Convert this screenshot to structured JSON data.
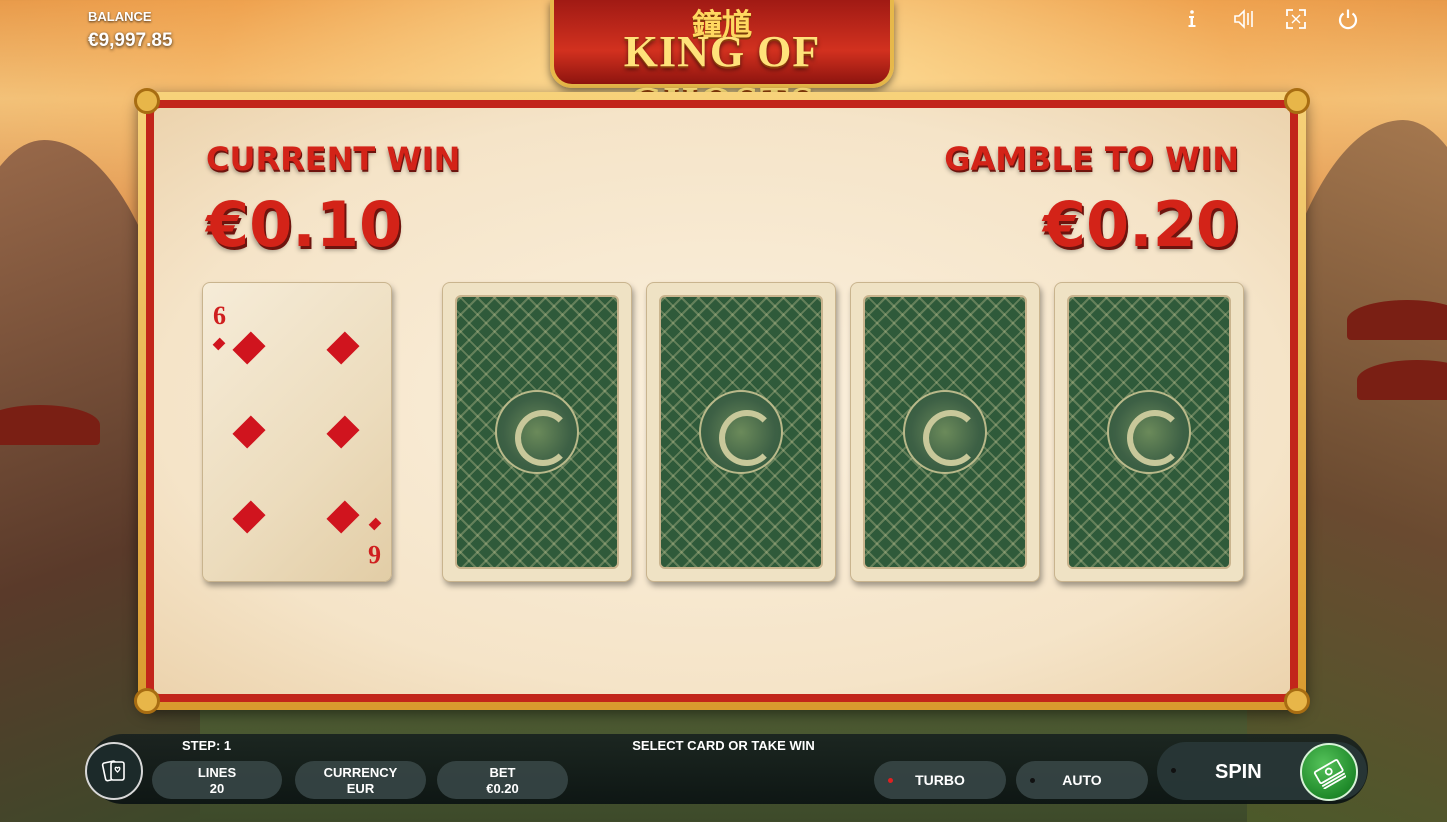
{
  "balance": {
    "label": "BALANCE",
    "value": "€9,997.85"
  },
  "top_icons": [
    "info-icon",
    "sound-icon",
    "fullscreen-icon",
    "power-icon"
  ],
  "logo": {
    "chinese": "鐘馗",
    "title": "KING OF GHOSTS"
  },
  "gamble": {
    "current_win_label": "CURRENT WIN",
    "current_win_value": "€0.10",
    "gamble_label": "GAMBLE TO WIN",
    "gamble_value": "€0.20",
    "dealer_card": {
      "rank": "6",
      "suit": "diamonds"
    },
    "face_down_cards": 4
  },
  "bottom": {
    "step_label": "STEP: 1",
    "message": "SELECT CARD OR TAKE WIN",
    "lines_label": "LINES",
    "lines_value": "20",
    "currency_label": "CURRENCY",
    "currency_value": "EUR",
    "bet_label": "BET",
    "bet_value": "€0.20",
    "turbo_label": "TURBO",
    "auto_label": "AUTO",
    "spin_label": "SPIN"
  },
  "colors": {
    "win_red": "#d32318",
    "turbo_dot": "#e02020",
    "spin_green": "#1f8a2a"
  }
}
